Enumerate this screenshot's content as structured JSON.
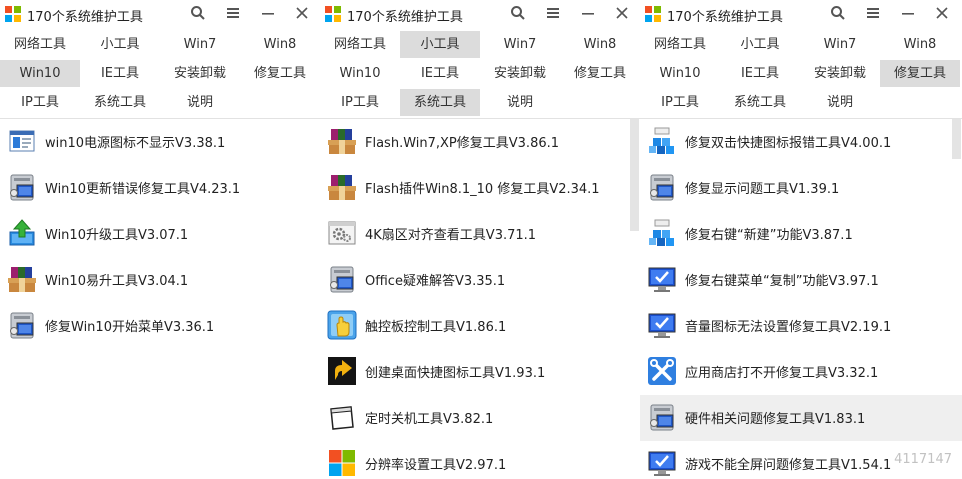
{
  "window_title": "170个系统维护工具",
  "tabs_row1": [
    "网络工具",
    "小工具",
    "Win7",
    "Win8"
  ],
  "tabs_row2": [
    "Win10",
    "IE工具",
    "安装卸载",
    "修复工具"
  ],
  "tabs_row3": [
    "IP工具",
    "系统工具",
    "说明"
  ],
  "panels": [
    {
      "active_tabs": [
        "Win10"
      ],
      "items": [
        {
          "label": "win10电源图标不显示V3.38.1",
          "icon": "power-settings-icon"
        },
        {
          "label": "Win10更新错误修复工具V4.23.1",
          "icon": "computer-repair-icon"
        },
        {
          "label": "Win10升级工具V3.07.1",
          "icon": "upgrade-arrow-icon"
        },
        {
          "label": "Win10易升工具V3.04.1",
          "icon": "winrar-box-icon"
        },
        {
          "label": "修复Win10开始菜单V3.36.1",
          "icon": "computer-repair-icon"
        }
      ]
    },
    {
      "active_tabs": [
        "小工具",
        "系统工具"
      ],
      "items": [
        {
          "label": "Flash.Win7,XP修复工具V3.86.1",
          "icon": "winrar-box-icon"
        },
        {
          "label": "Flash插件Win8.1_10 修复工具V2.34.1",
          "icon": "winrar-box-icon"
        },
        {
          "label": "4K扇区对齐查看工具V3.71.1",
          "icon": "gear-window-icon"
        },
        {
          "label": "Office疑难解答V3.35.1",
          "icon": "computer-repair-icon"
        },
        {
          "label": "触控板控制工具V1.86.1",
          "icon": "hand-touch-icon"
        },
        {
          "label": "创建桌面快捷图标工具V1.93.1",
          "icon": "shortcut-arrow-icon"
        },
        {
          "label": "定时关机工具V3.82.1",
          "icon": "blank-window-icon"
        },
        {
          "label": "分辨率设置工具V2.97.1",
          "icon": "windows-logo-icon"
        }
      ]
    },
    {
      "active_tabs": [
        "修复工具"
      ],
      "items": [
        {
          "label": "修复双击快捷图标报错工具V4.00.1",
          "icon": "blue-cubes-icon"
        },
        {
          "label": "修复显示问题工具V1.39.1",
          "icon": "computer-repair-icon"
        },
        {
          "label": "修复右键“新建”功能V3.87.1",
          "icon": "blue-cubes-icon"
        },
        {
          "label": "修复右键菜单“复制”功能V3.97.1",
          "icon": "monitor-check-icon"
        },
        {
          "label": "音量图标无法设置修复工具V2.19.1",
          "icon": "monitor-check-icon"
        },
        {
          "label": "应用商店打不开修复工具V3.32.1",
          "icon": "tools-blue-icon"
        },
        {
          "label": "硬件相关问题修复工具V1.83.1",
          "icon": "computer-repair-icon",
          "highlighted": true
        },
        {
          "label": "游戏不能全屏问题修复工具V1.54.1",
          "icon": "monitor-check-icon"
        }
      ]
    }
  ],
  "watermark": "4117147",
  "colors": {
    "active_tab": "#dcdcdc",
    "highlight_row": "#efefef",
    "logo": [
      "#f25022",
      "#7fba00",
      "#00a4ef",
      "#ffb900"
    ]
  }
}
